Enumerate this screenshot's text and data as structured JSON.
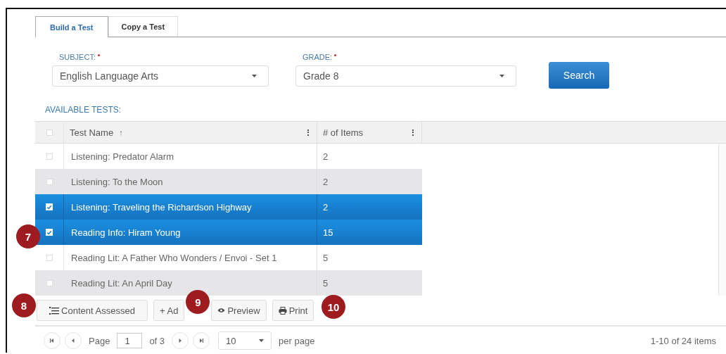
{
  "tabs": [
    {
      "label": "Build a Test",
      "selected": true
    },
    {
      "label": "Copy a Test",
      "selected": false
    }
  ],
  "filters": [
    {
      "label": "SUBJECT:",
      "required": true,
      "value": "English Language Arts"
    },
    {
      "label": "GRADE:",
      "required": true,
      "value": "Grade 8"
    }
  ],
  "search_button": "Search",
  "section_title": "AVAILABLE TESTS:",
  "table": {
    "select_all_checked": false,
    "columns": [
      {
        "label": "Test Name",
        "sort": "↑"
      },
      {
        "label": "# of Items"
      }
    ],
    "rows": [
      {
        "name": "Listening: Predator Alarm",
        "items": "2",
        "selected": false
      },
      {
        "name": "Listening: To the Moon",
        "items": "2",
        "selected": false
      },
      {
        "name": "Listening: Traveling the Richardson Highway",
        "items": "2",
        "selected": true
      },
      {
        "name": "Reading Info: Hiram Young",
        "items": "15",
        "selected": true
      },
      {
        "name": "Reading Lit: A Father Who Wonders / Envoi - Set 1",
        "items": "5",
        "selected": false
      },
      {
        "name": "Reading Lit: An April Day",
        "items": "5",
        "selected": false
      }
    ]
  },
  "toolbar": [
    {
      "kind": "list",
      "label": "Content Assessed"
    },
    {
      "kind": "plus",
      "label": "+ Ad"
    },
    {
      "kind": "eye",
      "label": "Preview"
    },
    {
      "kind": "print",
      "label": "Print"
    }
  ],
  "pager": {
    "page_label": "Page",
    "page": "1",
    "of_label": "of 3",
    "page_size": "10",
    "per_page_label": "per page",
    "summary": "1-10 of 24 items"
  },
  "callouts": [
    {
      "label": "7"
    },
    {
      "label": "8"
    },
    {
      "label": "9"
    },
    {
      "label": "10"
    }
  ]
}
